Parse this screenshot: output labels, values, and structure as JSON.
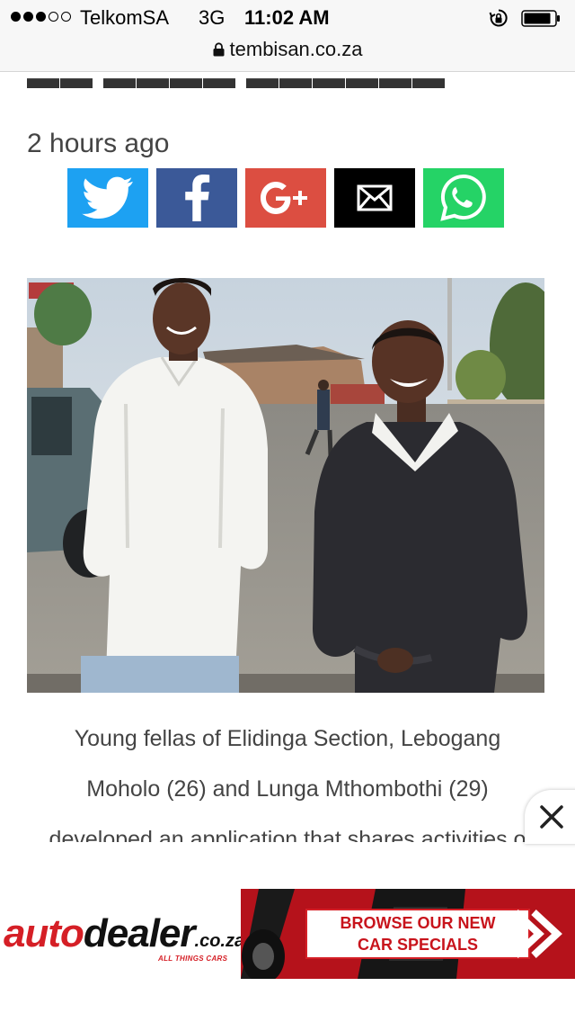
{
  "status_bar": {
    "carrier": "TelkomSA",
    "network": "3G",
    "time": "11:02 AM"
  },
  "browser": {
    "url": "tembisan.co.za"
  },
  "article": {
    "timestamp": "2 hours ago",
    "share_buttons": [
      {
        "name": "twitter",
        "icon": "twitter-bird-icon",
        "color": "#1da1f2"
      },
      {
        "name": "facebook",
        "icon": "facebook-f-icon",
        "color": "#3b5998"
      },
      {
        "name": "google-plus",
        "icon": "google-plus-icon",
        "color": "#dc4e41"
      },
      {
        "name": "email",
        "icon": "envelope-icon",
        "color": "#000000"
      },
      {
        "name": "whatsapp",
        "icon": "whatsapp-icon",
        "color": "#25d366"
      }
    ],
    "caption_lines": [
      "Young fellas of Elidinga Section, Lebogang",
      "Moholo (26) and Lunga Mthombothi (29)",
      "developed an application that shares activities o"
    ]
  },
  "ad": {
    "logo_auto": "auto",
    "logo_dealer": "dealer",
    "logo_suffix": ".co.za",
    "tagline": "ALL THINGS CARS",
    "cta_line1": "BROWSE OUR NEW",
    "cta_line2": "CAR SPECIALS",
    "brand_color": "#d51f26"
  }
}
